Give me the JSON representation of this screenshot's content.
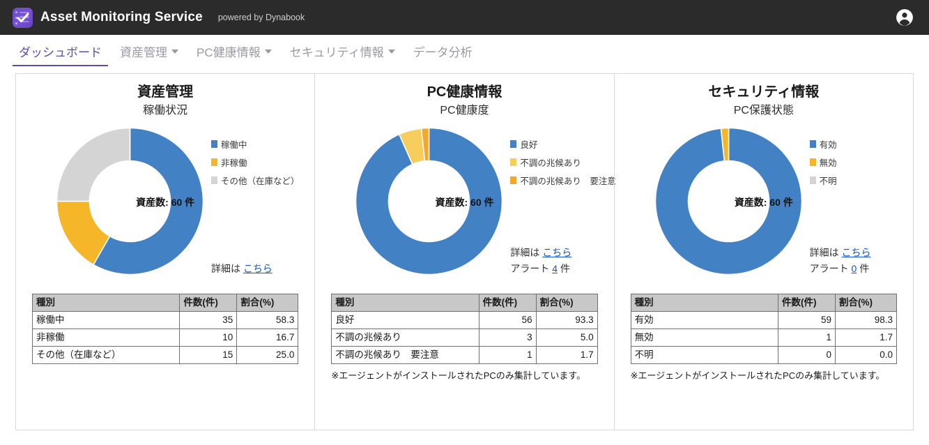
{
  "header": {
    "brand_title": "Asset Monitoring Service",
    "brand_subtitle": "powered by Dynabook",
    "logo_icon": "checklist-logo-icon",
    "account_icon": "account-circle-icon"
  },
  "nav": {
    "items": [
      {
        "label": "ダッシュボード",
        "active": true,
        "has_caret": false
      },
      {
        "label": "資産管理",
        "active": false,
        "has_caret": true
      },
      {
        "label": "PC健康情報",
        "active": false,
        "has_caret": true
      },
      {
        "label": "セキュリティ情報",
        "active": false,
        "has_caret": true
      },
      {
        "label": "データ分析",
        "active": false,
        "has_caret": false
      }
    ]
  },
  "colors": {
    "blue": "#4281c4",
    "orange": "#f6b629",
    "gray": "#d4d4d4",
    "light_yellow": "#f7ce5b",
    "amber": "#f4a72c",
    "accent_purple": "#5b4fa8",
    "link": "#1155cc",
    "table_header_bg": "#c8c8c8"
  },
  "table_headers": [
    "種別",
    "件数(件)",
    "割合(%)"
  ],
  "cards": [
    {
      "title": "資産管理",
      "subtitle": "稼働状況",
      "center_label": "資産数: 60 件",
      "detail_prefix": "詳細は",
      "detail_link": "こちら",
      "alert_prefix": "",
      "alert_count": "",
      "alert_suffix": "",
      "has_alert": false,
      "footnote": "",
      "rows": [
        {
          "name": "稼働中",
          "count": "35",
          "pct": "58.3"
        },
        {
          "name": "非稼働",
          "count": "10",
          "pct": "16.7"
        },
        {
          "name": "その他（在庫など）",
          "count": "15",
          "pct": "25.0"
        }
      ],
      "chart_data": {
        "type": "pie",
        "title": "稼働状況",
        "variant": "donut",
        "center_text": "資産数: 60 件",
        "total": 60,
        "legend_position": "right",
        "labels": [
          "稼働中",
          "非稼働",
          "その他（在庫など）"
        ],
        "values": [
          35,
          10,
          15
        ],
        "percentages": [
          58.3,
          16.7,
          25.0
        ],
        "colors": [
          "#4281c4",
          "#f6b629",
          "#d4d4d4"
        ]
      }
    },
    {
      "title": "PC健康情報",
      "subtitle": "PC健康度",
      "center_label": "資産数: 60 件",
      "detail_prefix": "詳細は",
      "detail_link": "こちら",
      "alert_prefix": "アラート",
      "alert_count": "4",
      "alert_suffix": "件",
      "has_alert": true,
      "footnote": "※エージェントがインストールされたPCのみ集計しています。",
      "rows": [
        {
          "name": "良好",
          "count": "56",
          "pct": "93.3"
        },
        {
          "name": "不調の兆候あり",
          "count": "3",
          "pct": "5.0"
        },
        {
          "name": "不調の兆候あり　要注意",
          "count": "1",
          "pct": "1.7"
        }
      ],
      "chart_data": {
        "type": "pie",
        "title": "PC健康度",
        "variant": "donut",
        "center_text": "資産数: 60 件",
        "total": 60,
        "legend_position": "right",
        "labels": [
          "良好",
          "不調の兆候あり",
          "不調の兆候あり　要注意"
        ],
        "values": [
          56,
          3,
          1
        ],
        "percentages": [
          93.3,
          5.0,
          1.7
        ],
        "colors": [
          "#4281c4",
          "#f7ce5b",
          "#f4a72c"
        ]
      }
    },
    {
      "title": "セキュリティ情報",
      "subtitle": "PC保護状態",
      "center_label": "資産数: 60 件",
      "detail_prefix": "詳細は",
      "detail_link": "こちら",
      "alert_prefix": "アラート",
      "alert_count": "0",
      "alert_suffix": "件",
      "has_alert": true,
      "footnote": "※エージェントがインストールされたPCのみ集計しています。",
      "rows": [
        {
          "name": "有効",
          "count": "59",
          "pct": "98.3"
        },
        {
          "name": "無効",
          "count": "1",
          "pct": "1.7"
        },
        {
          "name": "不明",
          "count": "0",
          "pct": "0.0"
        }
      ],
      "chart_data": {
        "type": "pie",
        "title": "PC保護状態",
        "variant": "donut",
        "center_text": "資産数: 60 件",
        "total": 60,
        "legend_position": "right",
        "labels": [
          "有効",
          "無効",
          "不明"
        ],
        "values": [
          59,
          1,
          0
        ],
        "percentages": [
          98.3,
          1.7,
          0.0
        ],
        "colors": [
          "#4281c4",
          "#f6b629",
          "#d4d4d4"
        ]
      }
    }
  ]
}
